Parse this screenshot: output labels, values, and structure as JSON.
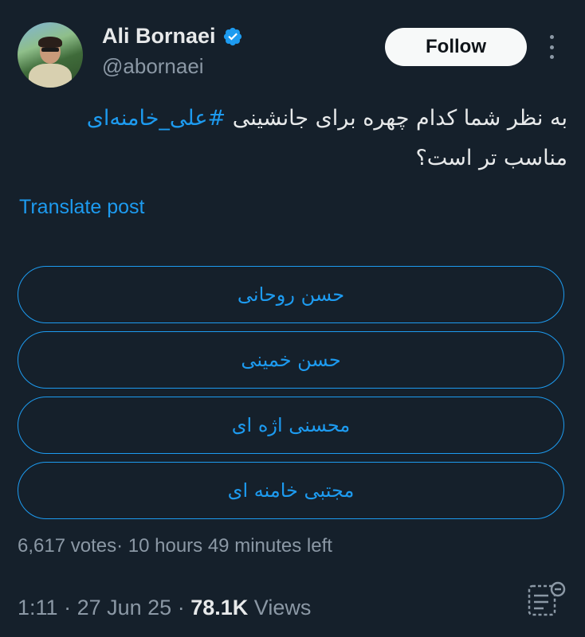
{
  "author": {
    "name": "Ali Bornaei",
    "handle": "@abornaei"
  },
  "follow_label": "Follow",
  "tweet": {
    "text_before_hashtag": "به نظر شما کدام چهره برای جانشینی ",
    "hashtag": "#علی_خامنه‌ای",
    "text_after_hashtag": " مناسب تر است؟"
  },
  "translate_label": "Translate post",
  "poll": {
    "options": [
      "حسن روحانی",
      "حسن خمینی",
      "محسنی اژه ای",
      "مجتبی خامنه ای"
    ],
    "votes": "6,617 votes",
    "separator": "·",
    "time_left": "10 hours 49 minutes left"
  },
  "footer": {
    "time": "1:11",
    "date": "27 Jun 25",
    "views_count": "78.1K",
    "views_label": "Views"
  },
  "colors": {
    "background": "#15202b",
    "accent": "#1d9bf0",
    "text_primary": "#e7e9ea",
    "text_secondary": "#8b98a5"
  },
  "icons": {
    "verified": "verified-badge-icon",
    "more": "more-options-icon",
    "notes": "community-notes-icon"
  }
}
